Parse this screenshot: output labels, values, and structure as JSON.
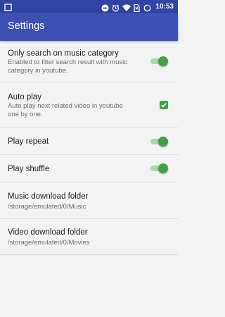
{
  "status_bar": {
    "time": "10:53",
    "icons": [
      "notification-square-icon",
      "do-not-disturb-icon",
      "alarm-icon",
      "wifi-icon",
      "no-sim-icon",
      "battery-icon"
    ]
  },
  "app_bar": {
    "title": "Settings",
    "color": "#3d51b5",
    "status_color": "#2f44a3"
  },
  "settings": [
    {
      "title": "Only search on music category",
      "subtitle": "Enabled to filter search result with music category in youtube.",
      "control": "switch",
      "checked": true
    },
    {
      "title": "Auto play",
      "subtitle": "Auto play next related video in youtube one by one.",
      "control": "checkbox",
      "checked": true
    },
    {
      "title": "Play repeat",
      "subtitle": "",
      "control": "switch",
      "checked": true
    },
    {
      "title": "Play shuffle",
      "subtitle": "",
      "control": "switch",
      "checked": true
    },
    {
      "title": "Music download folder",
      "subtitle": "/storage/emulated/0/Music",
      "control": "none"
    },
    {
      "title": "Video download folder",
      "subtitle": "/storage/emulated/0/Movies",
      "control": "none"
    }
  ],
  "accent_color": "#43a047"
}
